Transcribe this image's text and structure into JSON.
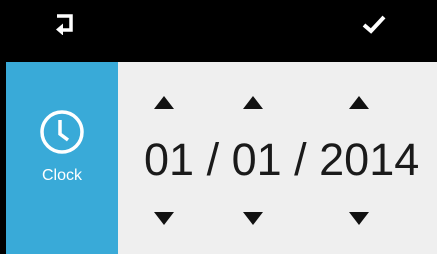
{
  "header": {
    "back_icon": "return-arrow-icon",
    "confirm_icon": "checkmark-icon"
  },
  "sidebar": {
    "icon": "clock-icon",
    "label": "Clock",
    "color": "#39aad8"
  },
  "date": {
    "month": "01",
    "day": "01",
    "year": "2014",
    "separator": " / "
  },
  "colors": {
    "background": "#000000",
    "panel": "#efefef",
    "accent": "#39aad8"
  }
}
